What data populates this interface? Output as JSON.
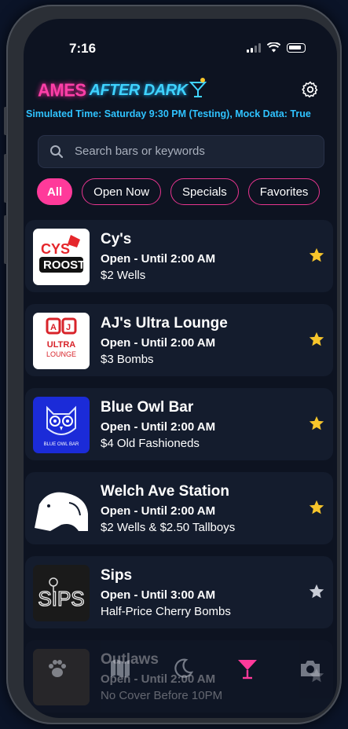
{
  "status_bar": {
    "time": "7:16"
  },
  "header": {
    "logo_ames": "AMES",
    "logo_after_dark": "AFTER DARK",
    "simulated_time": "Simulated Time: Saturday 9:30 PM (Testing), Mock Data: True"
  },
  "search": {
    "placeholder": "Search bars or keywords"
  },
  "filters": [
    "All",
    "Open Now",
    "Specials",
    "Favorites"
  ],
  "bars": [
    {
      "name": "Cy's",
      "status": "Open - Until 2:00 AM",
      "deal": "$2 Wells",
      "favorite": true,
      "logo_text": "Cy's Roost"
    },
    {
      "name": "AJ's Ultra Lounge",
      "status": "Open - Until 2:00 AM",
      "deal": "$3 Bombs",
      "favorite": true,
      "logo_text": "AJ's ULTRA LOUNGE"
    },
    {
      "name": "Blue Owl Bar",
      "status": "Open - Until 2:00 AM",
      "deal": "$4 Old Fashioneds",
      "favorite": true,
      "logo_text": "BLUE OWL BAR"
    },
    {
      "name": "Welch Ave Station",
      "status": "Open - Until 2:00 AM",
      "deal": "$2 Wells & $2.50 Tallboys",
      "favorite": true,
      "logo_text": ""
    },
    {
      "name": "Sips",
      "status": "Open - Until 3:00 AM",
      "deal": "Half-Price Cherry Bombs",
      "favorite": false,
      "logo_text": "Sips"
    },
    {
      "name": "Outlaws",
      "status": "Open - Until 2:00 AM",
      "deal": "No Cover Before 10PM",
      "favorite": false,
      "logo_text": ""
    }
  ],
  "tabs": [
    "paw-icon",
    "map-icon",
    "moon-icon",
    "cocktail-icon",
    "camera-icon"
  ],
  "colors": {
    "accent_pink": "#ff3a9a",
    "accent_cyan": "#2fc3ff",
    "star_gold": "#f7c52b",
    "background": "#0d1321",
    "card": "#141c2d"
  }
}
